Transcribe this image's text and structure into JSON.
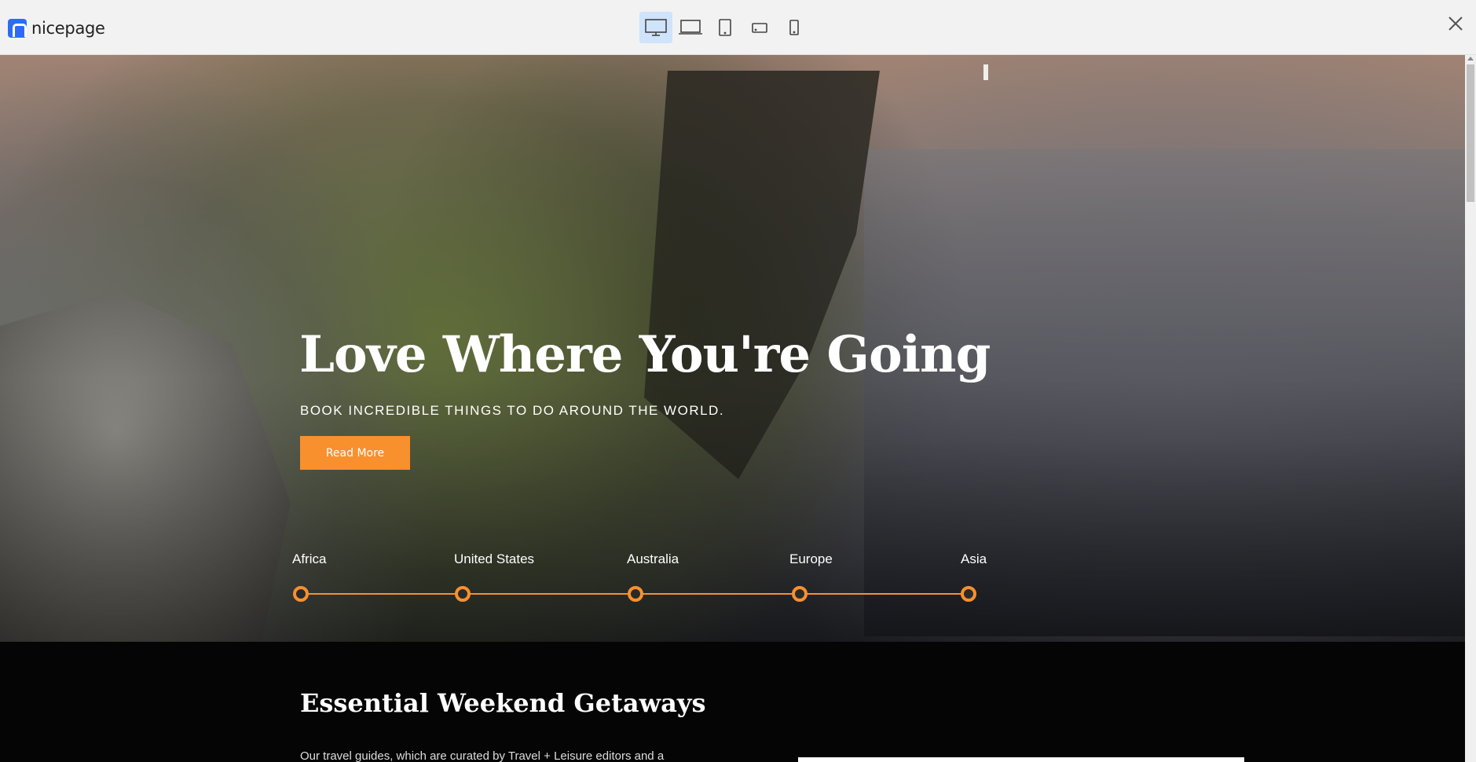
{
  "app": {
    "logo_text": "nicepage"
  },
  "toolbar": {
    "devices": [
      {
        "name": "desktop",
        "active": true
      },
      {
        "name": "laptop",
        "active": false
      },
      {
        "name": "tablet",
        "active": false
      },
      {
        "name": "phone-landscape",
        "active": false
      },
      {
        "name": "phone",
        "active": false
      }
    ],
    "close_icon": "close-icon"
  },
  "hero": {
    "title": "Love Where You're Going",
    "subtitle": "BOOK INCREDIBLE THINGS TO DO AROUND THE WORLD.",
    "button_label": "Read More",
    "accent_color": "#f8902e",
    "destinations": [
      "Africa",
      "United States",
      "Australia",
      "Europe",
      "Asia"
    ]
  },
  "section": {
    "title": "Essential Weekend Getaways",
    "text": "Our travel guides, which are curated by Travel + Leisure editors and a"
  }
}
